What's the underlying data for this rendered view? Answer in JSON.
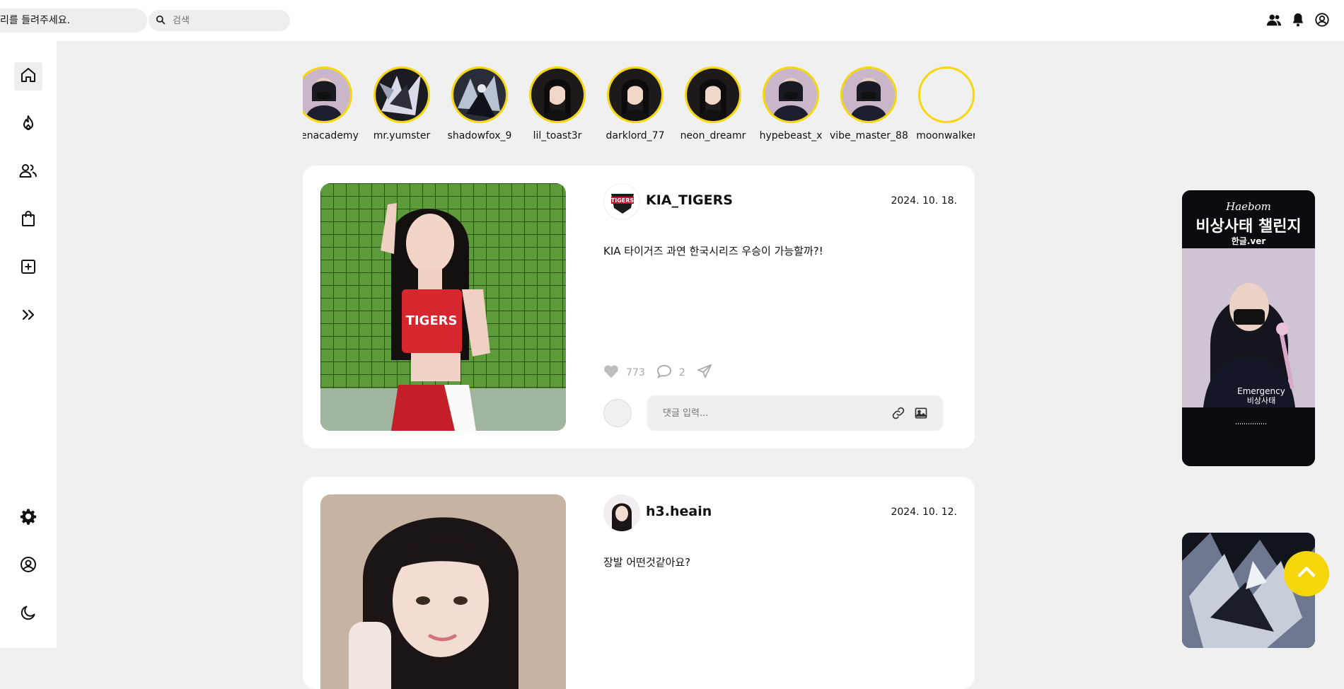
{
  "header": {
    "marquee_text": "리를 들려주세요.",
    "search_placeholder": "검색",
    "icons": [
      "people-icon",
      "bell-icon",
      "user-circle-icon"
    ]
  },
  "sidebar": {
    "top_items": [
      "home-icon",
      "fire-icon",
      "users-icon",
      "shopping-bag-icon",
      "plus-square-icon",
      "chevrons-right-icon"
    ],
    "bottom_items": [
      "gear-icon",
      "user-circle-icon",
      "moon-icon"
    ]
  },
  "stories": [
    {
      "name": "ezenacademy"
    },
    {
      "name": "mr.yumster"
    },
    {
      "name": "shadowfox_9"
    },
    {
      "name": "lil_toast3r"
    },
    {
      "name": "darklord_77"
    },
    {
      "name": "neon_dreamr"
    },
    {
      "name": "hypebeast_x"
    },
    {
      "name": "vibe_master_88"
    },
    {
      "name": "moonwalker"
    }
  ],
  "posts": [
    {
      "username": "KIA_TIGERS",
      "date": "2024. 10. 18.",
      "text": "KIA 타이거즈 과연 한국시리즈 우승이 가능할까?!",
      "likes": "773",
      "comments": "2",
      "comment_placeholder": "댓글 입력...",
      "image_jersey_text": "TIGERS",
      "logo_text": "TIGERS"
    },
    {
      "username": "h3.heain",
      "date": "2024. 10. 12.",
      "text": "장발 어떤것같아요?"
    }
  ],
  "ads": [
    {
      "brand": "Haebom",
      "title": "비상사태 챌린지",
      "subtitle": "한글.ver",
      "overlay_en": "Emergency",
      "overlay_ko": "비상사태"
    }
  ],
  "colors": {
    "accent": "#f5d60b",
    "background": "#f0f0f0",
    "surface": "#ffffff"
  }
}
